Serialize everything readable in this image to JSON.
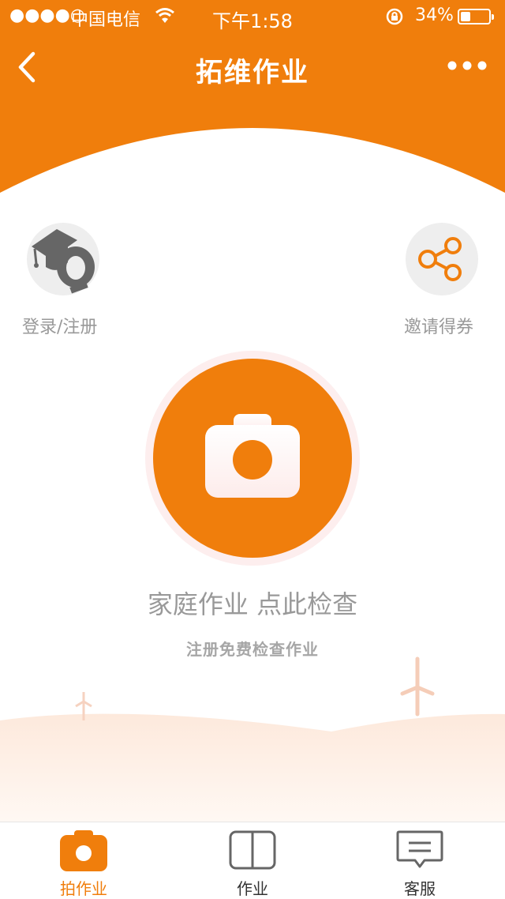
{
  "status_bar": {
    "signal": "●●●●○",
    "carrier": "中国电信",
    "time": "下午1:58",
    "battery_percent": "34%",
    "battery_level": 0.34
  },
  "nav": {
    "title": "拓维作业"
  },
  "quick_actions": {
    "login": {
      "label": "登录/注册",
      "icon": "graduation-cap-logo-icon"
    },
    "invite": {
      "label": "邀请得券",
      "icon": "share-icon"
    }
  },
  "main": {
    "camera_icon": "camera-icon",
    "title": "家庭作业 点此检查",
    "subtitle": "注册免费检查作业"
  },
  "tabbar": {
    "tabs": [
      {
        "label": "拍作业",
        "icon": "camera-icon",
        "active": true
      },
      {
        "label": "作业",
        "icon": "book-icon",
        "active": false
      },
      {
        "label": "客服",
        "icon": "message-icon",
        "active": false
      }
    ]
  },
  "colors": {
    "accent": "#f07e0c",
    "text_gray": "#999999",
    "tab_inactive": "#666666"
  }
}
